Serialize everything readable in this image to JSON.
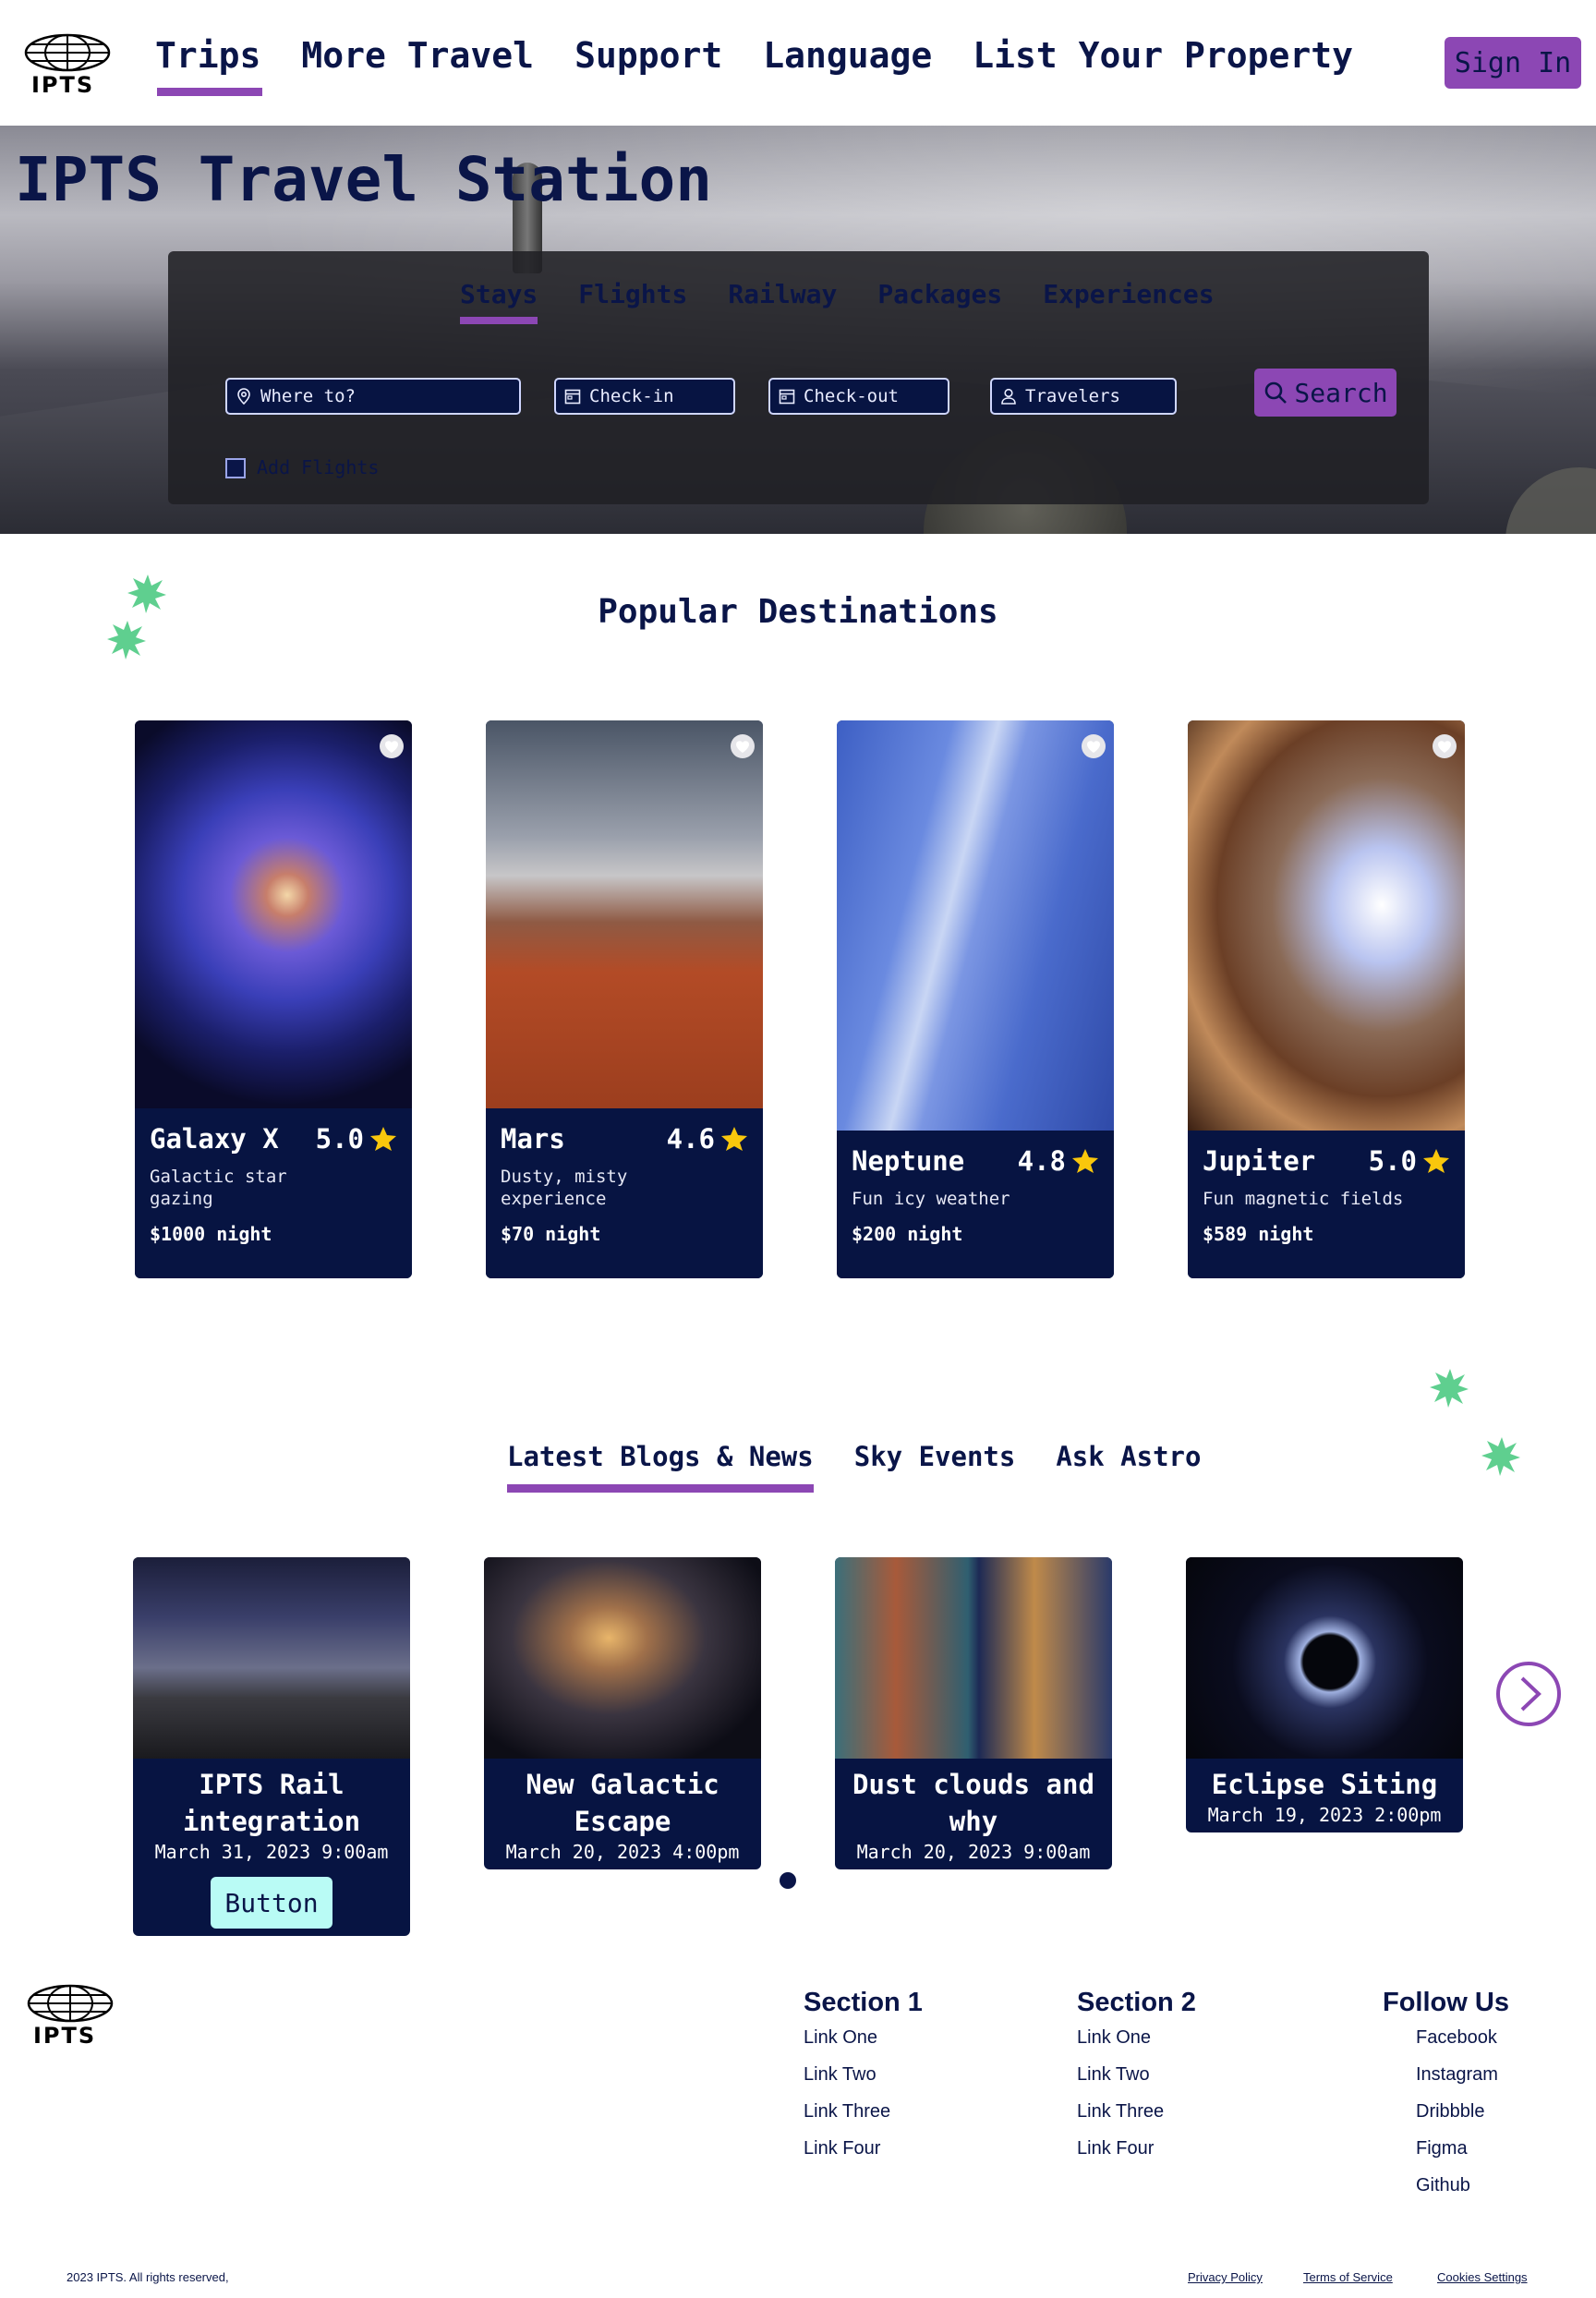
{
  "nav": {
    "logo_text": "IPTS",
    "links": [
      "Trips",
      "More Travel",
      "Support",
      "Language",
      "List Your Property"
    ],
    "signin_label": "Sign In"
  },
  "hero": {
    "title": "IPTS Travel Station",
    "tabs": [
      "Stays",
      "Flights",
      "Railway",
      "Packages",
      "Experiences"
    ],
    "fields": {
      "where_placeholder": "Where to?",
      "checkin_placeholder": "Check-in",
      "checkout_placeholder": "Check-out",
      "travelers_placeholder": "Travelers"
    },
    "search_label": "Search",
    "checkbox_label": "Add Flights"
  },
  "destinations": {
    "title": "Popular Destinations",
    "cards": [
      {
        "name": "Galaxy X",
        "rating": "5.0",
        "desc": "Galactic star gazing",
        "price": "$1000 night"
      },
      {
        "name": "Mars",
        "rating": "4.6",
        "desc": "Dusty, misty experience",
        "price": "$70 night"
      },
      {
        "name": "Neptune",
        "rating": "4.8",
        "desc": "Fun icy weather",
        "price": "$200 night"
      },
      {
        "name": "Jupiter",
        "rating": "5.0",
        "desc": "Fun magnetic fields",
        "price": "$589 night"
      }
    ]
  },
  "blogs": {
    "tabs": [
      "Latest Blogs & News",
      "Sky Events",
      "Ask Astro"
    ],
    "cards": [
      {
        "title": "IPTS Rail integration",
        "date": "March 31, 2023 9:00am",
        "button": "Button"
      },
      {
        "title": "New Galactic Escape",
        "date": "March 20, 2023 4:00pm"
      },
      {
        "title": "Dust clouds and why",
        "date": "March 20, 2023 9:00am"
      },
      {
        "title": "Eclipse Siting",
        "date": "March 19, 2023 2:00pm"
      }
    ]
  },
  "footer": {
    "logo_text": "IPTS",
    "section1": {
      "title": "Section 1",
      "links": [
        "Link One",
        "Link Two",
        "Link Three",
        "Link Four"
      ]
    },
    "section2": {
      "title": "Section 2",
      "links": [
        "Link One",
        "Link Two",
        "Link Three",
        "Link Four"
      ]
    },
    "follow": {
      "title": "Follow Us",
      "links": [
        "Facebook",
        "Instagram",
        "Dribbble",
        "Figma",
        "Github"
      ]
    },
    "copyright": "2023 IPTS. All rights reserved,",
    "legal": [
      "Privacy Policy",
      "Terms of Service",
      "Cookies Settings"
    ]
  },
  "colors": {
    "navy": "#0a1548",
    "purple": "#8c47b4",
    "mint": "#b9fbf5",
    "star": "#f9c70c",
    "sparkle": "#5fcf8f"
  }
}
